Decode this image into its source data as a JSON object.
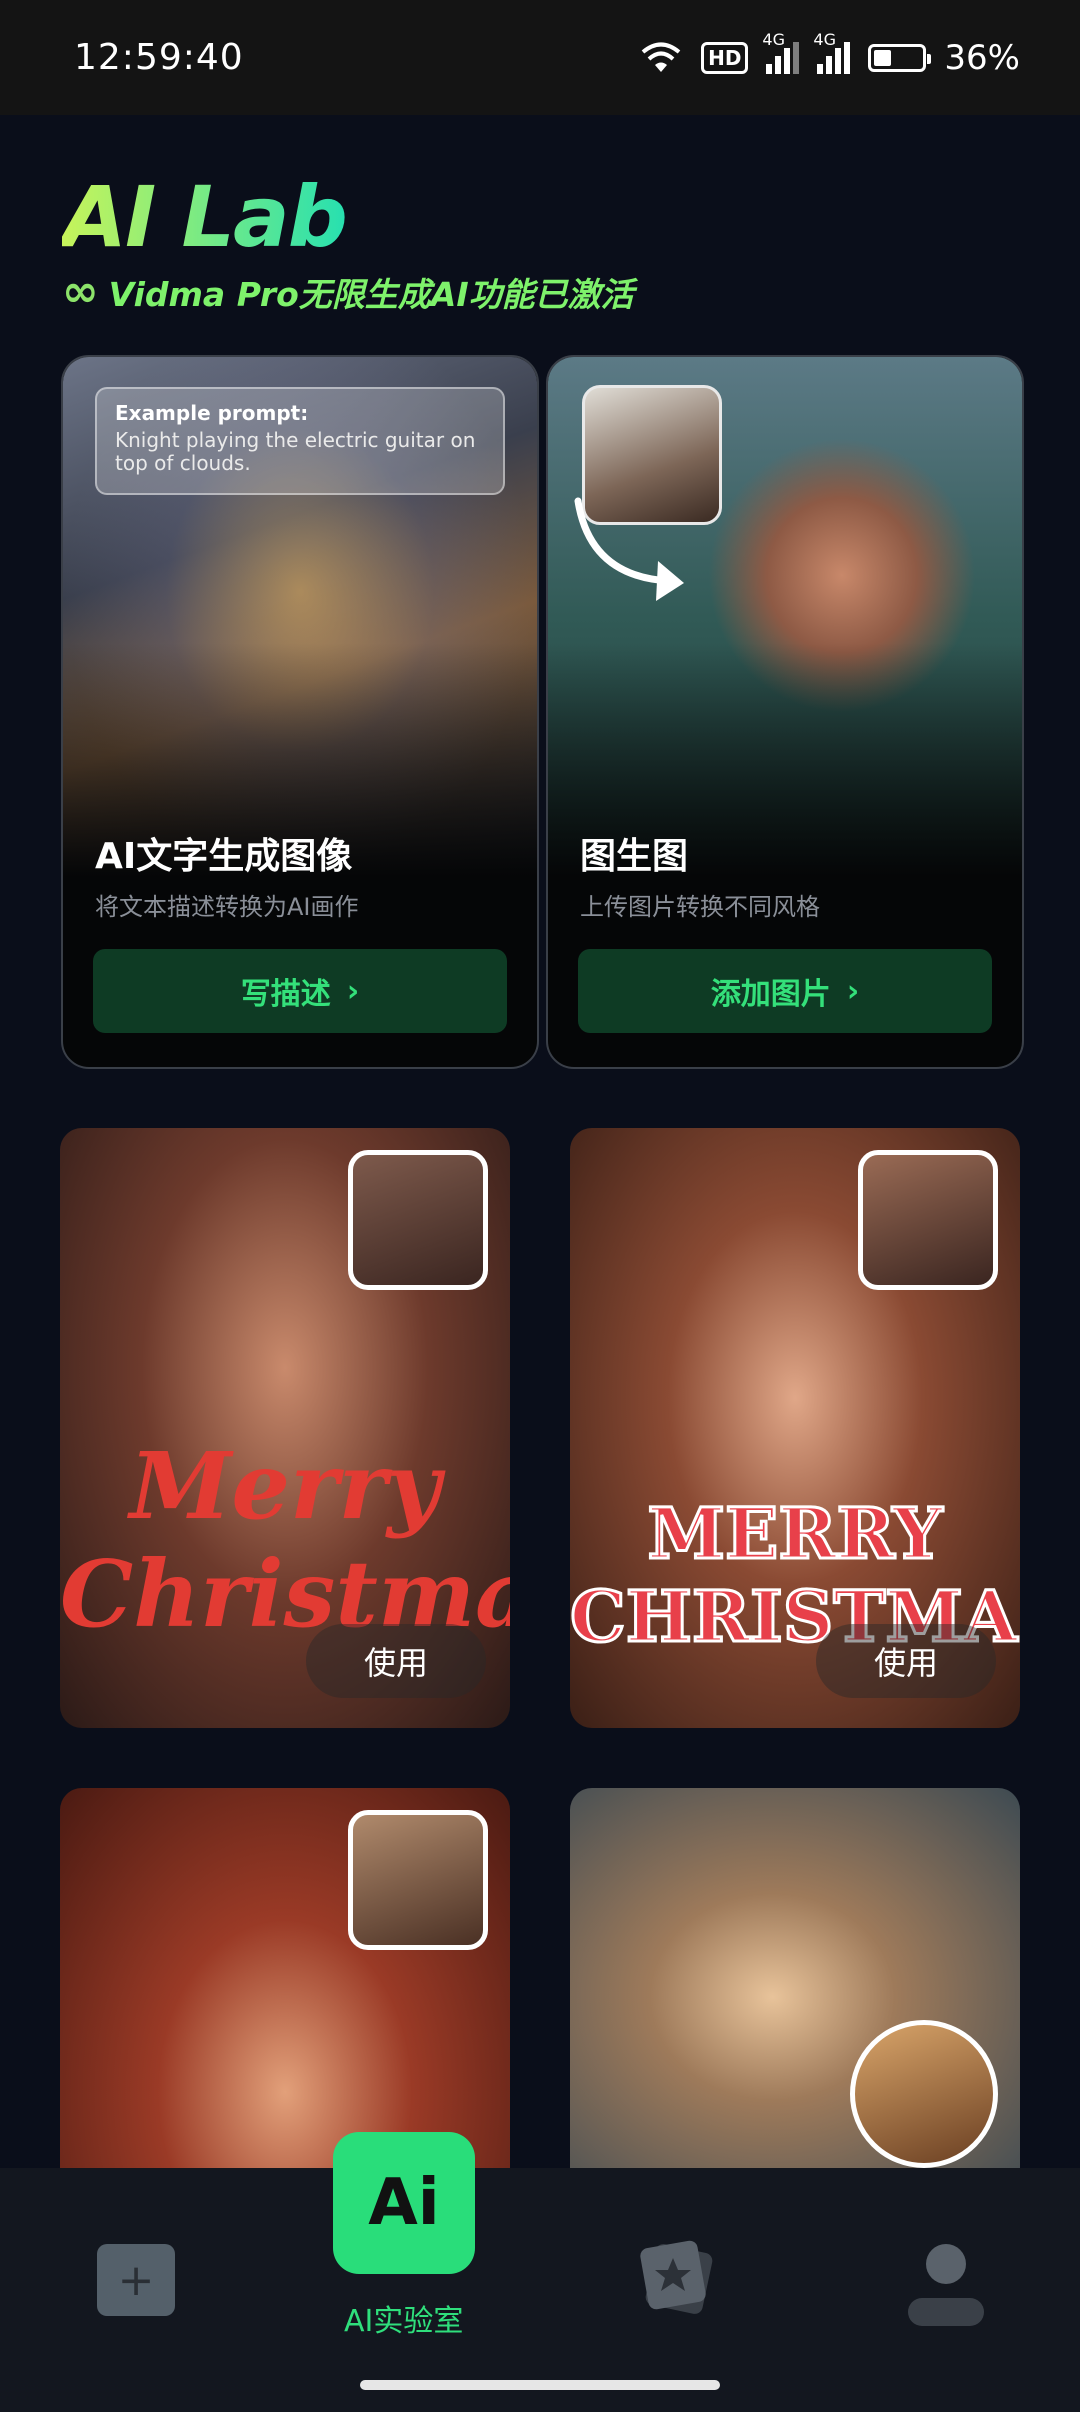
{
  "status_bar": {
    "time": "12:59:40",
    "hd_label": "HD",
    "net1": "4G",
    "net2": "4G",
    "battery": "36%",
    "battery_level": 0.36
  },
  "header": {
    "title": "AI Lab",
    "subtitle": "Vidma Pro无限生成AI功能已激活"
  },
  "features": [
    {
      "prompt_title": "Example prompt:",
      "prompt_text": "Knight playing the electric guitar on top of clouds.",
      "title": "AI文字生成图像",
      "desc": "将文本描述转换为AI画作",
      "button": "写描述"
    },
    {
      "title": "图生图",
      "desc": "上传图片转换不同风格",
      "button": "添加图片"
    }
  ],
  "templates": [
    {
      "overlay": "Merry Christmas",
      "use_label": "使用"
    },
    {
      "overlay": "MERRY CHRISTMAS",
      "use_label": "使用"
    },
    {
      "overlay": ""
    },
    {
      "overlay": ""
    }
  ],
  "bottom_nav": {
    "ai_icon_text": "Ai",
    "ai_label": "AI实验室"
  },
  "colors": {
    "accent": "#29dd7a",
    "background": "#0a0e1a",
    "button_bg": "#0e3b24"
  }
}
